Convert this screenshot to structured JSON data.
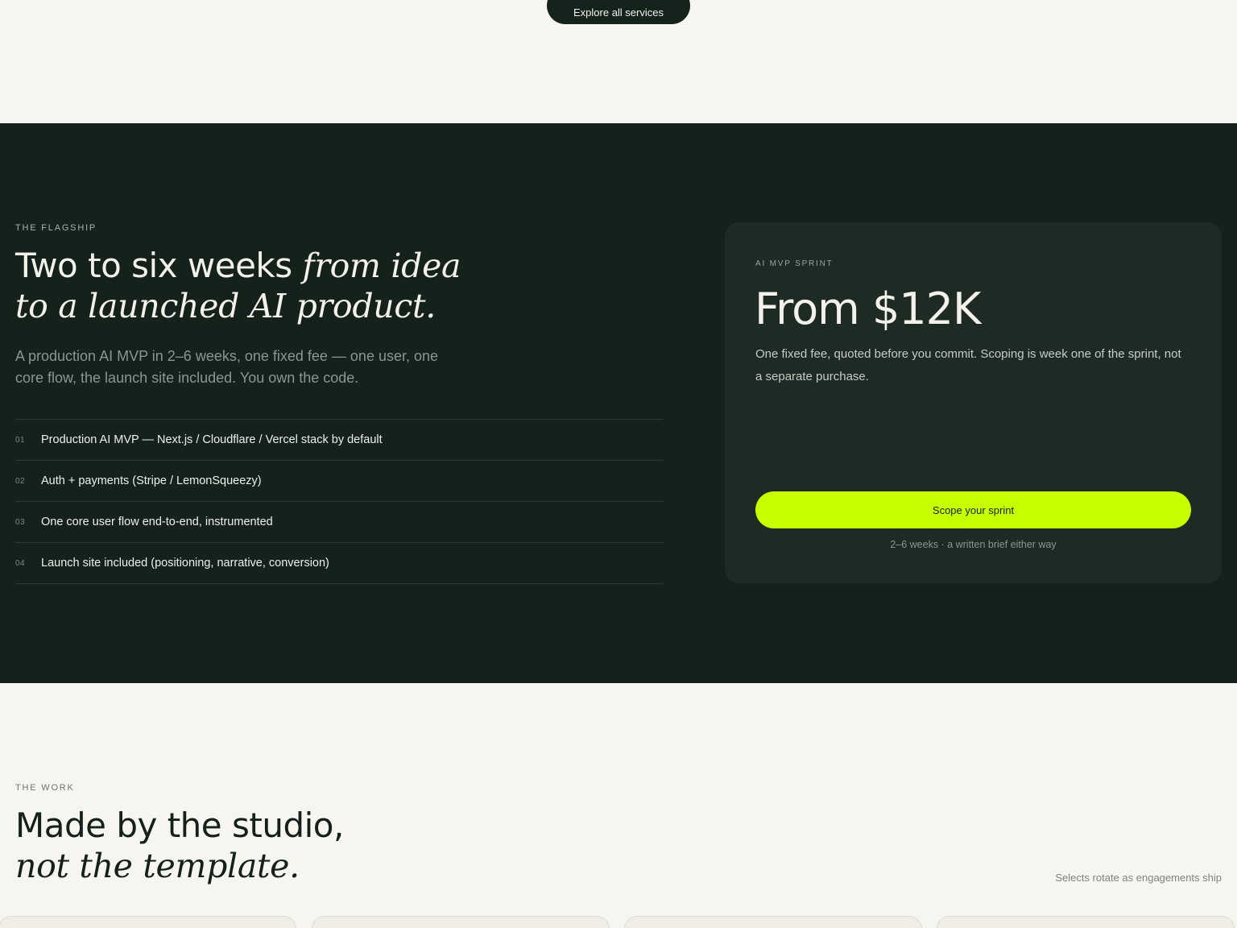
{
  "top": {
    "explore_label": "Explore all services"
  },
  "flagship": {
    "eyebrow": "THE FLAGSHIP",
    "title_line1": "Two to six weeks ",
    "title_line1_italic": "from idea",
    "title_line2_italic": "to a launched AI product.",
    "lead": "A production AI MVP in 2–6 weeks, one fixed fee — one user, one core flow, the launch site included. You own the code.",
    "features": [
      {
        "num": "01",
        "text": "Production AI MVP — Next.js / Cloudflare / Vercel stack by default"
      },
      {
        "num": "02",
        "text": "Auth + payments (Stripe / LemonSqueezy)"
      },
      {
        "num": "03",
        "text": "One core user flow end-to-end, instrumented"
      },
      {
        "num": "04",
        "text": "Launch site included (positioning, narrative, conversion)"
      }
    ],
    "card": {
      "eyebrow": "AI MVP SPRINT",
      "price": "From $12K",
      "description": "One fixed fee, quoted before you commit. Scoping is week one of the sprint, not a separate purchase.",
      "cta_label": "Scope your sprint",
      "note": "2–6 weeks · a written brief either way"
    }
  },
  "work": {
    "eyebrow": "THE WORK",
    "title_line1": "Made by the studio,",
    "title_line2_italic": "not the template.",
    "note": "Selects rotate as engagements ship"
  },
  "colors": {
    "dark": "#15221c",
    "card": "#1d2b24",
    "accent": "#c6ff00",
    "cream": "#f7f5f0"
  }
}
